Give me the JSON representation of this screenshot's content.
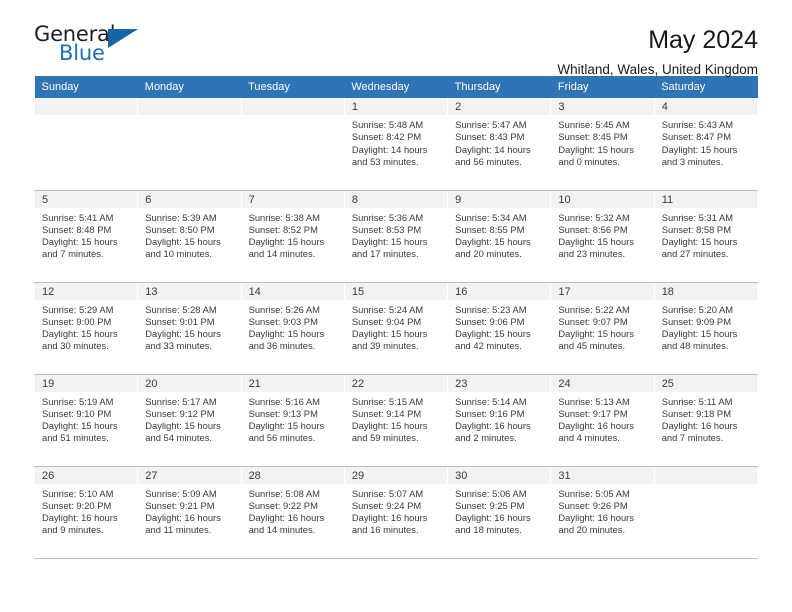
{
  "brand": {
    "name_top": "General",
    "name_bottom": "Blue",
    "accent_color": "#1d6fb8",
    "triangle_color": "#1565a8"
  },
  "header": {
    "title": "May 2024",
    "subtitle": "Whitland, Wales, United Kingdom",
    "header_row_color": "#2f75b5"
  },
  "calendar": {
    "weekday_headers": [
      "Sunday",
      "Monday",
      "Tuesday",
      "Wednesday",
      "Thursday",
      "Friday",
      "Saturday"
    ],
    "weeks": [
      [
        {
          "day": "",
          "sunrise": "",
          "sunset": "",
          "daylight1": "",
          "daylight2": "",
          "empty": true
        },
        {
          "day": "",
          "sunrise": "",
          "sunset": "",
          "daylight1": "",
          "daylight2": "",
          "empty": true
        },
        {
          "day": "",
          "sunrise": "",
          "sunset": "",
          "daylight1": "",
          "daylight2": "",
          "empty": true
        },
        {
          "day": "1",
          "sunrise": "Sunrise: 5:48 AM",
          "sunset": "Sunset: 8:42 PM",
          "daylight1": "Daylight: 14 hours",
          "daylight2": "and 53 minutes."
        },
        {
          "day": "2",
          "sunrise": "Sunrise: 5:47 AM",
          "sunset": "Sunset: 8:43 PM",
          "daylight1": "Daylight: 14 hours",
          "daylight2": "and 56 minutes."
        },
        {
          "day": "3",
          "sunrise": "Sunrise: 5:45 AM",
          "sunset": "Sunset: 8:45 PM",
          "daylight1": "Daylight: 15 hours",
          "daylight2": "and 0 minutes."
        },
        {
          "day": "4",
          "sunrise": "Sunrise: 5:43 AM",
          "sunset": "Sunset: 8:47 PM",
          "daylight1": "Daylight: 15 hours",
          "daylight2": "and 3 minutes."
        }
      ],
      [
        {
          "day": "5",
          "sunrise": "Sunrise: 5:41 AM",
          "sunset": "Sunset: 8:48 PM",
          "daylight1": "Daylight: 15 hours",
          "daylight2": "and 7 minutes."
        },
        {
          "day": "6",
          "sunrise": "Sunrise: 5:39 AM",
          "sunset": "Sunset: 8:50 PM",
          "daylight1": "Daylight: 15 hours",
          "daylight2": "and 10 minutes."
        },
        {
          "day": "7",
          "sunrise": "Sunrise: 5:38 AM",
          "sunset": "Sunset: 8:52 PM",
          "daylight1": "Daylight: 15 hours",
          "daylight2": "and 14 minutes."
        },
        {
          "day": "8",
          "sunrise": "Sunrise: 5:36 AM",
          "sunset": "Sunset: 8:53 PM",
          "daylight1": "Daylight: 15 hours",
          "daylight2": "and 17 minutes."
        },
        {
          "day": "9",
          "sunrise": "Sunrise: 5:34 AM",
          "sunset": "Sunset: 8:55 PM",
          "daylight1": "Daylight: 15 hours",
          "daylight2": "and 20 minutes."
        },
        {
          "day": "10",
          "sunrise": "Sunrise: 5:32 AM",
          "sunset": "Sunset: 8:56 PM",
          "daylight1": "Daylight: 15 hours",
          "daylight2": "and 23 minutes."
        },
        {
          "day": "11",
          "sunrise": "Sunrise: 5:31 AM",
          "sunset": "Sunset: 8:58 PM",
          "daylight1": "Daylight: 15 hours",
          "daylight2": "and 27 minutes."
        }
      ],
      [
        {
          "day": "12",
          "sunrise": "Sunrise: 5:29 AM",
          "sunset": "Sunset: 9:00 PM",
          "daylight1": "Daylight: 15 hours",
          "daylight2": "and 30 minutes."
        },
        {
          "day": "13",
          "sunrise": "Sunrise: 5:28 AM",
          "sunset": "Sunset: 9:01 PM",
          "daylight1": "Daylight: 15 hours",
          "daylight2": "and 33 minutes."
        },
        {
          "day": "14",
          "sunrise": "Sunrise: 5:26 AM",
          "sunset": "Sunset: 9:03 PM",
          "daylight1": "Daylight: 15 hours",
          "daylight2": "and 36 minutes."
        },
        {
          "day": "15",
          "sunrise": "Sunrise: 5:24 AM",
          "sunset": "Sunset: 9:04 PM",
          "daylight1": "Daylight: 15 hours",
          "daylight2": "and 39 minutes."
        },
        {
          "day": "16",
          "sunrise": "Sunrise: 5:23 AM",
          "sunset": "Sunset: 9:06 PM",
          "daylight1": "Daylight: 15 hours",
          "daylight2": "and 42 minutes."
        },
        {
          "day": "17",
          "sunrise": "Sunrise: 5:22 AM",
          "sunset": "Sunset: 9:07 PM",
          "daylight1": "Daylight: 15 hours",
          "daylight2": "and 45 minutes."
        },
        {
          "day": "18",
          "sunrise": "Sunrise: 5:20 AM",
          "sunset": "Sunset: 9:09 PM",
          "daylight1": "Daylight: 15 hours",
          "daylight2": "and 48 minutes."
        }
      ],
      [
        {
          "day": "19",
          "sunrise": "Sunrise: 5:19 AM",
          "sunset": "Sunset: 9:10 PM",
          "daylight1": "Daylight: 15 hours",
          "daylight2": "and 51 minutes."
        },
        {
          "day": "20",
          "sunrise": "Sunrise: 5:17 AM",
          "sunset": "Sunset: 9:12 PM",
          "daylight1": "Daylight: 15 hours",
          "daylight2": "and 54 minutes."
        },
        {
          "day": "21",
          "sunrise": "Sunrise: 5:16 AM",
          "sunset": "Sunset: 9:13 PM",
          "daylight1": "Daylight: 15 hours",
          "daylight2": "and 56 minutes."
        },
        {
          "day": "22",
          "sunrise": "Sunrise: 5:15 AM",
          "sunset": "Sunset: 9:14 PM",
          "daylight1": "Daylight: 15 hours",
          "daylight2": "and 59 minutes."
        },
        {
          "day": "23",
          "sunrise": "Sunrise: 5:14 AM",
          "sunset": "Sunset: 9:16 PM",
          "daylight1": "Daylight: 16 hours",
          "daylight2": "and 2 minutes."
        },
        {
          "day": "24",
          "sunrise": "Sunrise: 5:13 AM",
          "sunset": "Sunset: 9:17 PM",
          "daylight1": "Daylight: 16 hours",
          "daylight2": "and 4 minutes."
        },
        {
          "day": "25",
          "sunrise": "Sunrise: 5:11 AM",
          "sunset": "Sunset: 9:18 PM",
          "daylight1": "Daylight: 16 hours",
          "daylight2": "and 7 minutes."
        }
      ],
      [
        {
          "day": "26",
          "sunrise": "Sunrise: 5:10 AM",
          "sunset": "Sunset: 9:20 PM",
          "daylight1": "Daylight: 16 hours",
          "daylight2": "and 9 minutes."
        },
        {
          "day": "27",
          "sunrise": "Sunrise: 5:09 AM",
          "sunset": "Sunset: 9:21 PM",
          "daylight1": "Daylight: 16 hours",
          "daylight2": "and 11 minutes."
        },
        {
          "day": "28",
          "sunrise": "Sunrise: 5:08 AM",
          "sunset": "Sunset: 9:22 PM",
          "daylight1": "Daylight: 16 hours",
          "daylight2": "and 14 minutes."
        },
        {
          "day": "29",
          "sunrise": "Sunrise: 5:07 AM",
          "sunset": "Sunset: 9:24 PM",
          "daylight1": "Daylight: 16 hours",
          "daylight2": "and 16 minutes."
        },
        {
          "day": "30",
          "sunrise": "Sunrise: 5:06 AM",
          "sunset": "Sunset: 9:25 PM",
          "daylight1": "Daylight: 16 hours",
          "daylight2": "and 18 minutes."
        },
        {
          "day": "31",
          "sunrise": "Sunrise: 5:05 AM",
          "sunset": "Sunset: 9:26 PM",
          "daylight1": "Daylight: 16 hours",
          "daylight2": "and 20 minutes."
        },
        {
          "day": "",
          "sunrise": "",
          "sunset": "",
          "daylight1": "",
          "daylight2": "",
          "empty": true
        }
      ]
    ]
  }
}
